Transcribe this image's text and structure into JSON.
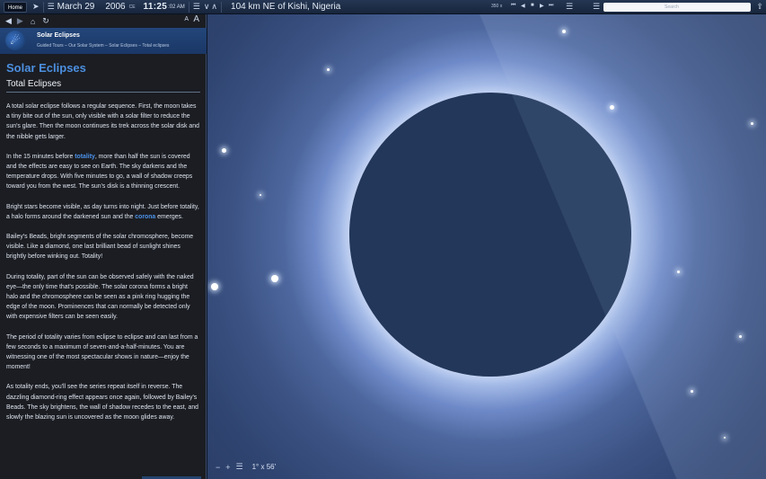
{
  "toolbar": {
    "home_label": "Home",
    "date_month": "March 29",
    "date_year": "2006",
    "date_era": "CE",
    "time": "11:25",
    "time_seconds": ":02 AM",
    "location": "104 km NE of Kishi, Nigeria",
    "rate": "350 x",
    "search_placeholder": "Search"
  },
  "sidepanel": {
    "font_small": "A",
    "font_large": "A",
    "guide_title": "Solar Eclipses",
    "breadcrumb": "Guided Tours – Our Solar System – Solar Eclipses – Total eclipses",
    "page_title": "Solar Eclipses",
    "subtitle": "Total Eclipses",
    "paragraphs": {
      "p1": "A total solar eclipse follows a regular sequence. First, the moon takes a tiny bite out of the sun, only visible with a solar filter to reduce the sun's glare. Then the moon continues its trek across the solar disk and the nibble gets larger.",
      "p2a": "In the 15 minutes before ",
      "p2_term": "totality",
      "p2b": ", more than half the sun is covered and the effects are easy to see on Earth. The sky darkens and the temperature drops. With five minutes to go, a wall of shadow creeps toward you from the west. The sun's disk is a thinning crescent.",
      "p3a": "Bright stars become visible, as day turns into night. Just before totality, a halo forms around the darkened sun and the ",
      "p3_term": "corona",
      "p3b": " emerges.",
      "p4": "Bailey's Beads, bright segments of the solar chromosphere, become visible. Like a diamond, one last brilliant bead of sunlight shines brightly before winking out. Totality!",
      "p5": "During totality, part of the sun can be observed safely with the naked eye—the only time that's possible. The solar corona forms a bright halo and the chromosphere can be seen as a pink ring hugging the edge of the moon. Prominences that can normally be detected only with expensive filters can be seen easily.",
      "p6": "The period of totality varies from eclipse to eclipse and can last from a few seconds to a maximum of seven-and-a-half-minutes. You are witnessing one of the most spectacular shows in nature—enjoy the moment!",
      "p7": "As totality ends, you'll see the series repeat itself in reverse. The dazzling diamond-ring effect appears once again, followed by Bailey's Beads. The sky brightens, the wall of shadow recedes to the east, and slowly the blazing sun is uncovered as the moon glides away."
    }
  },
  "sky": {
    "zoom_out": "−",
    "zoom_in": "+",
    "fov": "1° x 56'"
  },
  "icons": {
    "toolbar": [
      "home-button",
      "cursor-icon",
      "menu-icon",
      "time-flow-icon",
      "step-back-icon",
      "play-icon",
      "stop-icon",
      "step-forward-icon",
      "list-icon",
      "search-input",
      "share-icon"
    ],
    "panel": [
      "back-arrow-icon",
      "forward-arrow-icon",
      "home-icon",
      "refresh-icon",
      "solar-system-logo-icon"
    ]
  },
  "colors": {
    "accent_blue": "#4c8fe0",
    "guide_header": "#23467a",
    "panel_background": "#1b1d22",
    "moon_disk": "#22375a",
    "corona_white": "#eef3ff"
  }
}
